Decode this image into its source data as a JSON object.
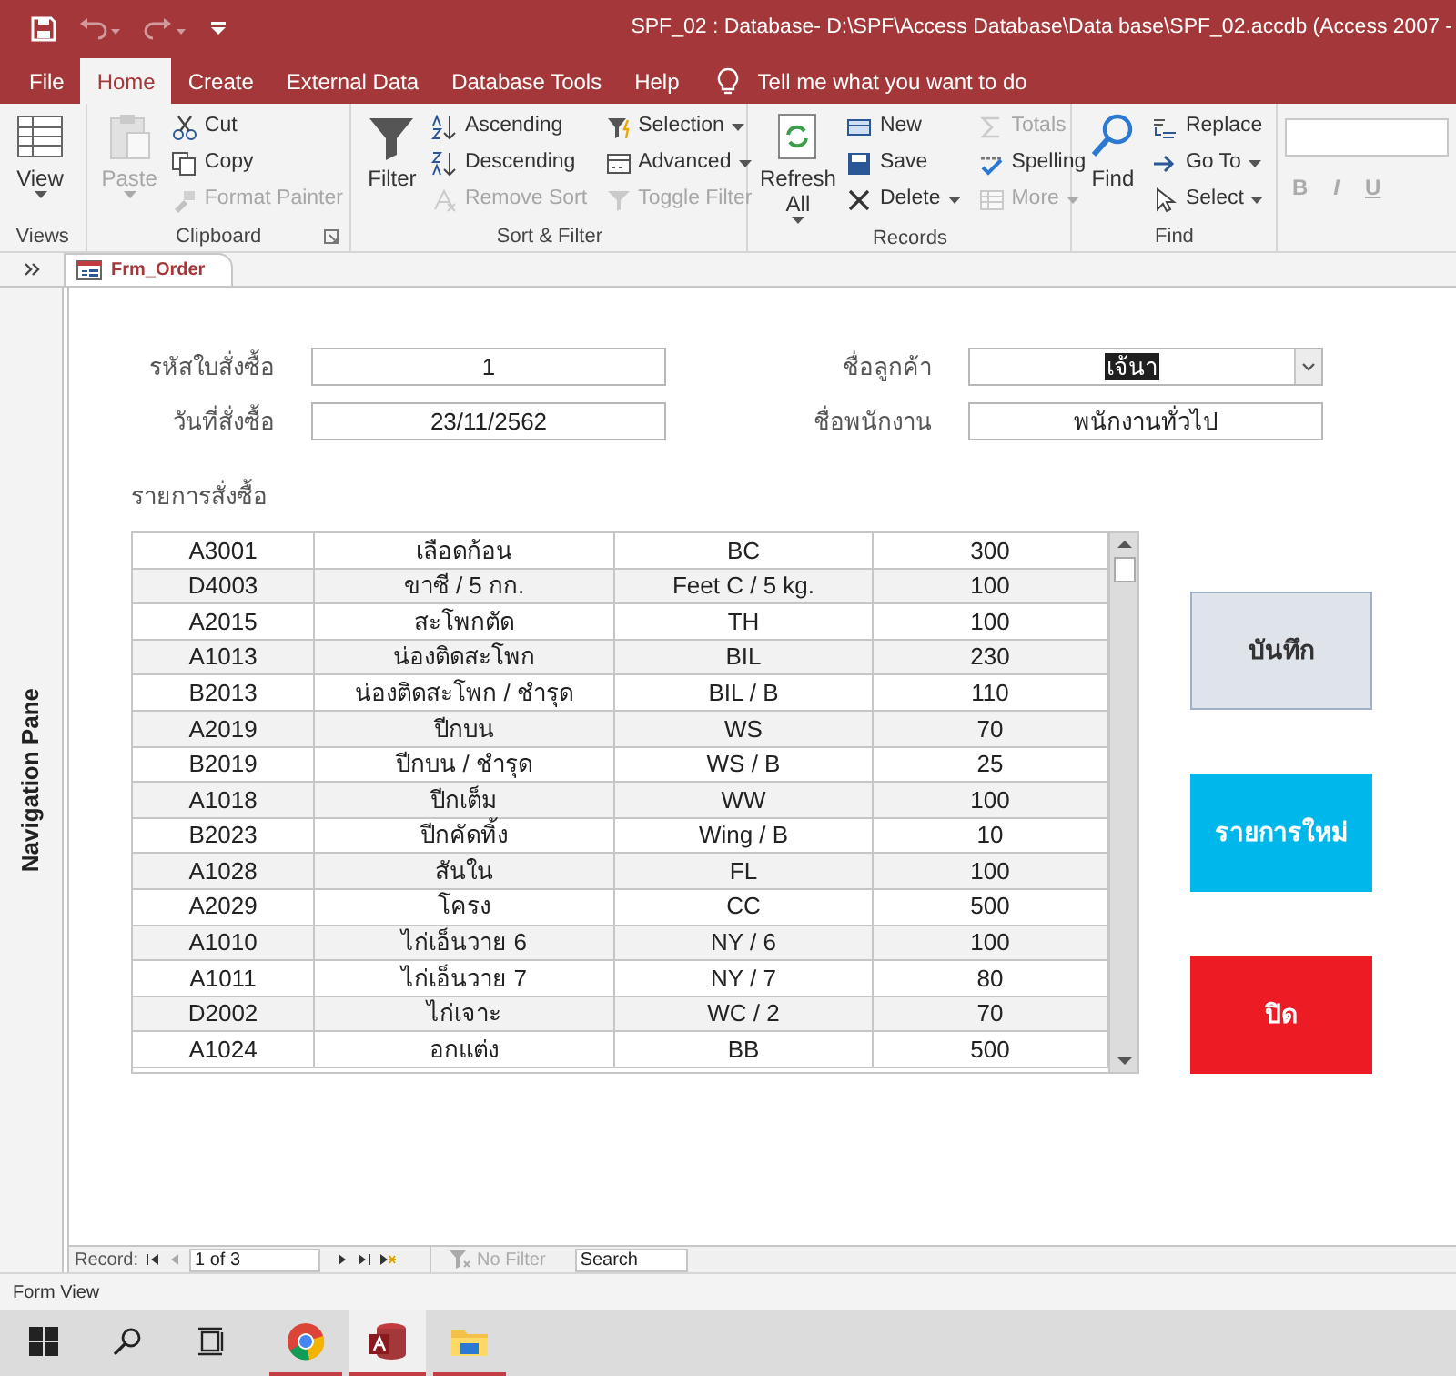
{
  "window": {
    "title": "SPF_02 : Database- D:\\SPF\\Access Database\\Data base\\SPF_02.accdb (Access 2007 -",
    "quick_access": [
      {
        "kind": "save",
        "disabled": false
      },
      {
        "kind": "undo",
        "disabled": true
      },
      {
        "kind": "redo",
        "disabled": true
      },
      {
        "kind": "customize",
        "disabled": false
      }
    ]
  },
  "menu": {
    "tabs": [
      {
        "label": "File",
        "selected": false
      },
      {
        "label": "Home",
        "selected": true
      },
      {
        "label": "Create",
        "selected": false
      },
      {
        "label": "External Data",
        "selected": false
      },
      {
        "label": "Database Tools",
        "selected": false
      },
      {
        "label": "Help",
        "selected": false
      }
    ],
    "tell_me": "Tell me what you want to do"
  },
  "ribbon": {
    "groups": [
      {
        "label": "Views",
        "launcher": false,
        "items": [
          {
            "kind": "large",
            "label": "View",
            "disabled": false,
            "dropdown": true
          }
        ]
      },
      {
        "label": "Clipboard",
        "launcher": true,
        "items": [
          {
            "kind": "large",
            "label": "Paste",
            "disabled": true,
            "dropdown": true
          },
          {
            "kind": "small",
            "label": "Cut",
            "disabled": false,
            "dropdown": false
          },
          {
            "kind": "small",
            "label": "Copy",
            "disabled": false,
            "dropdown": false
          },
          {
            "kind": "small",
            "label": "Format Painter",
            "disabled": true,
            "dropdown": false
          }
        ]
      },
      {
        "label": "Sort & Filter",
        "launcher": false,
        "items": [
          {
            "kind": "large",
            "label": "Filter",
            "disabled": false,
            "dropdown": false
          },
          {
            "kind": "small",
            "label": "Ascending",
            "disabled": false,
            "dropdown": false
          },
          {
            "kind": "small",
            "label": "Descending",
            "disabled": false,
            "dropdown": false
          },
          {
            "kind": "small",
            "label": "Remove Sort",
            "disabled": true,
            "dropdown": false
          },
          {
            "kind": "small",
            "label": "Selection",
            "disabled": false,
            "dropdown": true
          },
          {
            "kind": "small",
            "label": "Advanced",
            "disabled": false,
            "dropdown": true
          },
          {
            "kind": "small",
            "label": "Toggle Filter",
            "disabled": true,
            "dropdown": false
          }
        ]
      },
      {
        "label": "Records",
        "launcher": false,
        "items": [
          {
            "kind": "large",
            "label": "Refresh All",
            "disabled": false,
            "dropdown": true
          },
          {
            "kind": "small",
            "label": "New",
            "disabled": false,
            "dropdown": false
          },
          {
            "kind": "small",
            "label": "Save",
            "disabled": false,
            "dropdown": false
          },
          {
            "kind": "small",
            "label": "Delete",
            "disabled": false,
            "dropdown": true
          },
          {
            "kind": "small",
            "label": "Totals",
            "disabled": true,
            "dropdown": false
          },
          {
            "kind": "small",
            "label": "Spelling",
            "disabled": false,
            "dropdown": false
          },
          {
            "kind": "small",
            "label": "More",
            "disabled": true,
            "dropdown": true
          }
        ]
      },
      {
        "label": "Find",
        "launcher": false,
        "items": [
          {
            "kind": "large",
            "label": "Find",
            "disabled": false,
            "dropdown": false
          },
          {
            "kind": "small",
            "label": "Replace",
            "disabled": false,
            "dropdown": false
          },
          {
            "kind": "small",
            "label": "Go To",
            "disabled": false,
            "dropdown": true
          },
          {
            "kind": "small",
            "label": "Select",
            "disabled": false,
            "dropdown": true
          }
        ]
      },
      {
        "items": [
          {
            "kind": "field",
            "disabled": true
          },
          {
            "kind": "letter",
            "label": "B",
            "disabled": true
          },
          {
            "kind": "letter",
            "label": "I",
            "disabled": true
          },
          {
            "kind": "letter",
            "label": "U",
            "disabled": true
          }
        ]
      }
    ]
  },
  "document_tabs": [
    {
      "label": "Frm_Order",
      "selected": true
    }
  ],
  "navigation_pane": {
    "label": "Navigation Pane"
  },
  "form": {
    "fields": [
      {
        "label": "รหัสใบสั่งซื้อ",
        "value": "1",
        "kind": "text",
        "value_selected": false
      },
      {
        "label": "ชื่อลูกค้า",
        "value": "เจ้นา",
        "kind": "combo",
        "value_selected": true
      },
      {
        "label": "วันที่สั่งซื้อ",
        "value": "23/11/2562",
        "kind": "text",
        "value_selected": false
      },
      {
        "label": "ชื่อพนักงาน",
        "value": "พนักงานทั่วไป",
        "kind": "text",
        "value_selected": false
      }
    ],
    "section_label": "รายการสั่งซื้อ",
    "rows": [
      [
        "A3001",
        "เลือดก้อน",
        "BC",
        "300"
      ],
      [
        "D4003",
        "ขาซี / 5 กก.",
        "Feet C / 5 kg.",
        "100"
      ],
      [
        "A2015",
        "สะโพกตัด",
        "TH",
        "100"
      ],
      [
        "A1013",
        "น่องติดสะโพก",
        "BIL",
        "230"
      ],
      [
        "B2013",
        "น่องติดสะโพก / ชำรุด",
        "BIL / B",
        "110"
      ],
      [
        "A2019",
        "ปีกบน",
        "WS",
        "70"
      ],
      [
        "B2019",
        "ปีกบน / ชำรุด",
        "WS / B",
        "25"
      ],
      [
        "A1018",
        "ปีกเต็ม",
        "WW",
        "100"
      ],
      [
        "B2023",
        "ปีกคัดทิ้ง",
        "Wing / B",
        "10"
      ],
      [
        "A1028",
        "สันใน",
        "FL",
        "100"
      ],
      [
        "A2029",
        "โครง",
        "CC",
        "500"
      ],
      [
        "A1010",
        "ไก่เอ็นวาย 6",
        "NY / 6",
        "100"
      ],
      [
        "A1011",
        "ไก่เอ็นวาย 7",
        "NY / 7",
        "80"
      ],
      [
        "D2002",
        "ไก่เจาะ",
        "WC / 2",
        "70"
      ],
      [
        "A1024",
        "อกแต่ง",
        "BB",
        "500"
      ]
    ],
    "buttons": [
      {
        "label": "บันทึก",
        "color": "#dfe3ea"
      },
      {
        "label": "รายการใหม่",
        "color": "#00b7eb"
      },
      {
        "label": "ปิด",
        "color": "#ed1c24"
      }
    ]
  },
  "record_bar": {
    "label": "Record:",
    "position": "1 of 3",
    "filter": "No Filter",
    "search": "Search"
  },
  "status_bar": {
    "text": "Form View"
  },
  "taskbar": [
    {
      "kind": "start",
      "running": false,
      "selected": false
    },
    {
      "kind": "search",
      "running": false,
      "selected": false
    },
    {
      "kind": "taskview",
      "running": false,
      "selected": false
    },
    {
      "kind": "chrome",
      "running": true,
      "selected": false
    },
    {
      "kind": "access",
      "running": true,
      "selected": true
    },
    {
      "kind": "explorer",
      "running": true,
      "selected": false
    }
  ]
}
